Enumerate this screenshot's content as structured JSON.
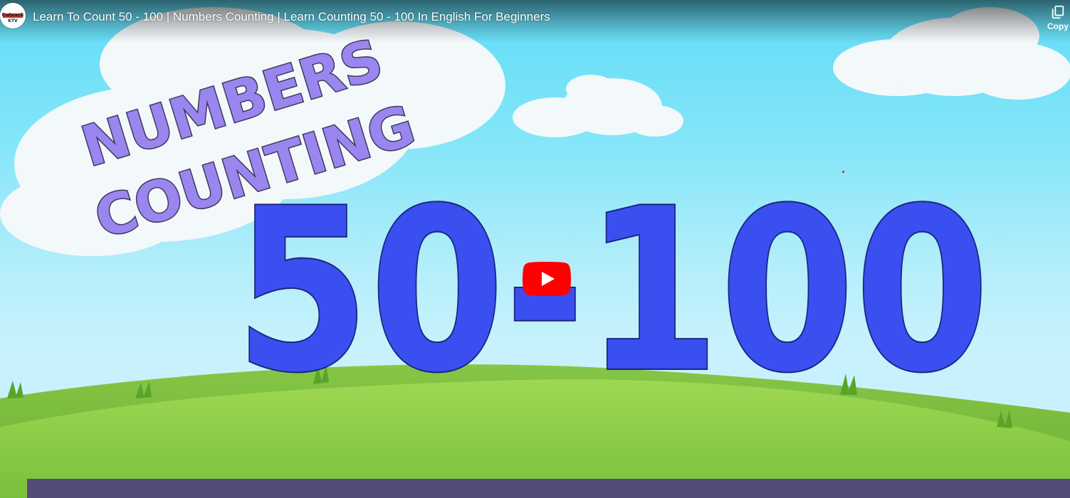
{
  "player": {
    "title": "Learn To Count 50 - 100 | Numbers Counting | Learn Counting 50 - 100 In English For Beginners",
    "copy_label": "Copy",
    "channel_avatar": {
      "text_top": "Cutzack",
      "text_bottom": "KTV"
    },
    "icons": [
      "channel-avatar",
      "copy-icon",
      "play-icon"
    ]
  },
  "thumbnail": {
    "headline_line1": "NUMBERS",
    "headline_line2": "COUNTING",
    "range_text": "50-100",
    "colors": {
      "sky_top": "#5fdcf6",
      "headline_fill": "#9b86f0",
      "numbers_fill": "#3a4ff0",
      "hill": "#7cbe3d",
      "bottom_strip": "#544c78",
      "play_button": "#ff0000"
    }
  }
}
